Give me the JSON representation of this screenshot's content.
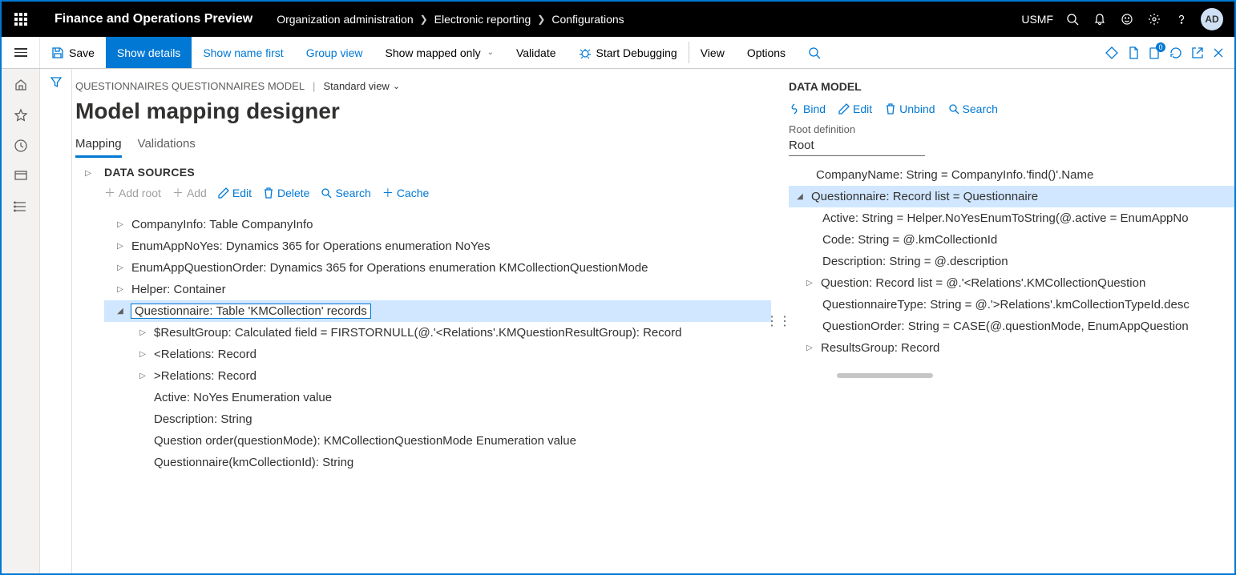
{
  "header": {
    "app_title": "Finance and Operations Preview",
    "crumbs": [
      "Organization administration",
      "Electronic reporting",
      "Configurations"
    ],
    "company": "USMF",
    "avatar": "AD"
  },
  "actionbar": {
    "save": "Save",
    "show_details": "Show details",
    "show_name_first": "Show name first",
    "group_view": "Group view",
    "show_mapped_only": "Show mapped only",
    "validate": "Validate",
    "start_debugging": "Start Debugging",
    "view": "View",
    "options": "Options",
    "badge": "0"
  },
  "page": {
    "path": "QUESTIONNAIRES QUESTIONNAIRES MODEL",
    "view": "Standard view",
    "title": "Model mapping designer",
    "tabs": {
      "mapping": "Mapping",
      "validations": "Validations"
    }
  },
  "ds": {
    "title": "DATA SOURCES",
    "btns": {
      "add_root": "Add root",
      "add": "Add",
      "edit": "Edit",
      "delete": "Delete",
      "search": "Search",
      "cache": "Cache"
    },
    "nodes": {
      "company": "CompanyInfo: Table CompanyInfo",
      "enum_noyes": "EnumAppNoYes: Dynamics 365 for Operations enumeration NoYes",
      "enum_qorder": "EnumAppQuestionOrder: Dynamics 365 for Operations enumeration KMCollectionQuestionMode",
      "helper": "Helper: Container",
      "questionnaire": "Questionnaire: Table 'KMCollection' records",
      "resultgroup": "$ResultGroup: Calculated field = FIRSTORNULL(@.'<Relations'.KMQuestionResultGroup): Record",
      "rel_back": "<Relations: Record",
      "rel_fwd": ">Relations: Record",
      "active": "Active: NoYes Enumeration value",
      "description": "Description: String",
      "qorder": "Question order(questionMode): KMCollectionQuestionMode Enumeration value",
      "qid": "Questionnaire(kmCollectionId): String"
    }
  },
  "dm": {
    "title": "DATA MODEL",
    "btns": {
      "bind": "Bind",
      "edit": "Edit",
      "unbind": "Unbind",
      "search": "Search"
    },
    "root_label": "Root definition",
    "root_value": "Root",
    "nodes": {
      "company": "CompanyName: String = CompanyInfo.'find()'.Name",
      "questionnaire": "Questionnaire: Record list = Questionnaire",
      "active": "Active: String = Helper.NoYesEnumToString(@.active = EnumAppNo",
      "code": "Code: String = @.kmCollectionId",
      "description": "Description: String = @.description",
      "question": "Question: Record list = @.'<Relations'.KMCollectionQuestion",
      "qtype": "QuestionnaireType: String = @.'>Relations'.kmCollectionTypeId.desc",
      "qorder": "QuestionOrder: String = CASE(@.questionMode, EnumAppQuestion",
      "results": "ResultsGroup: Record"
    }
  }
}
